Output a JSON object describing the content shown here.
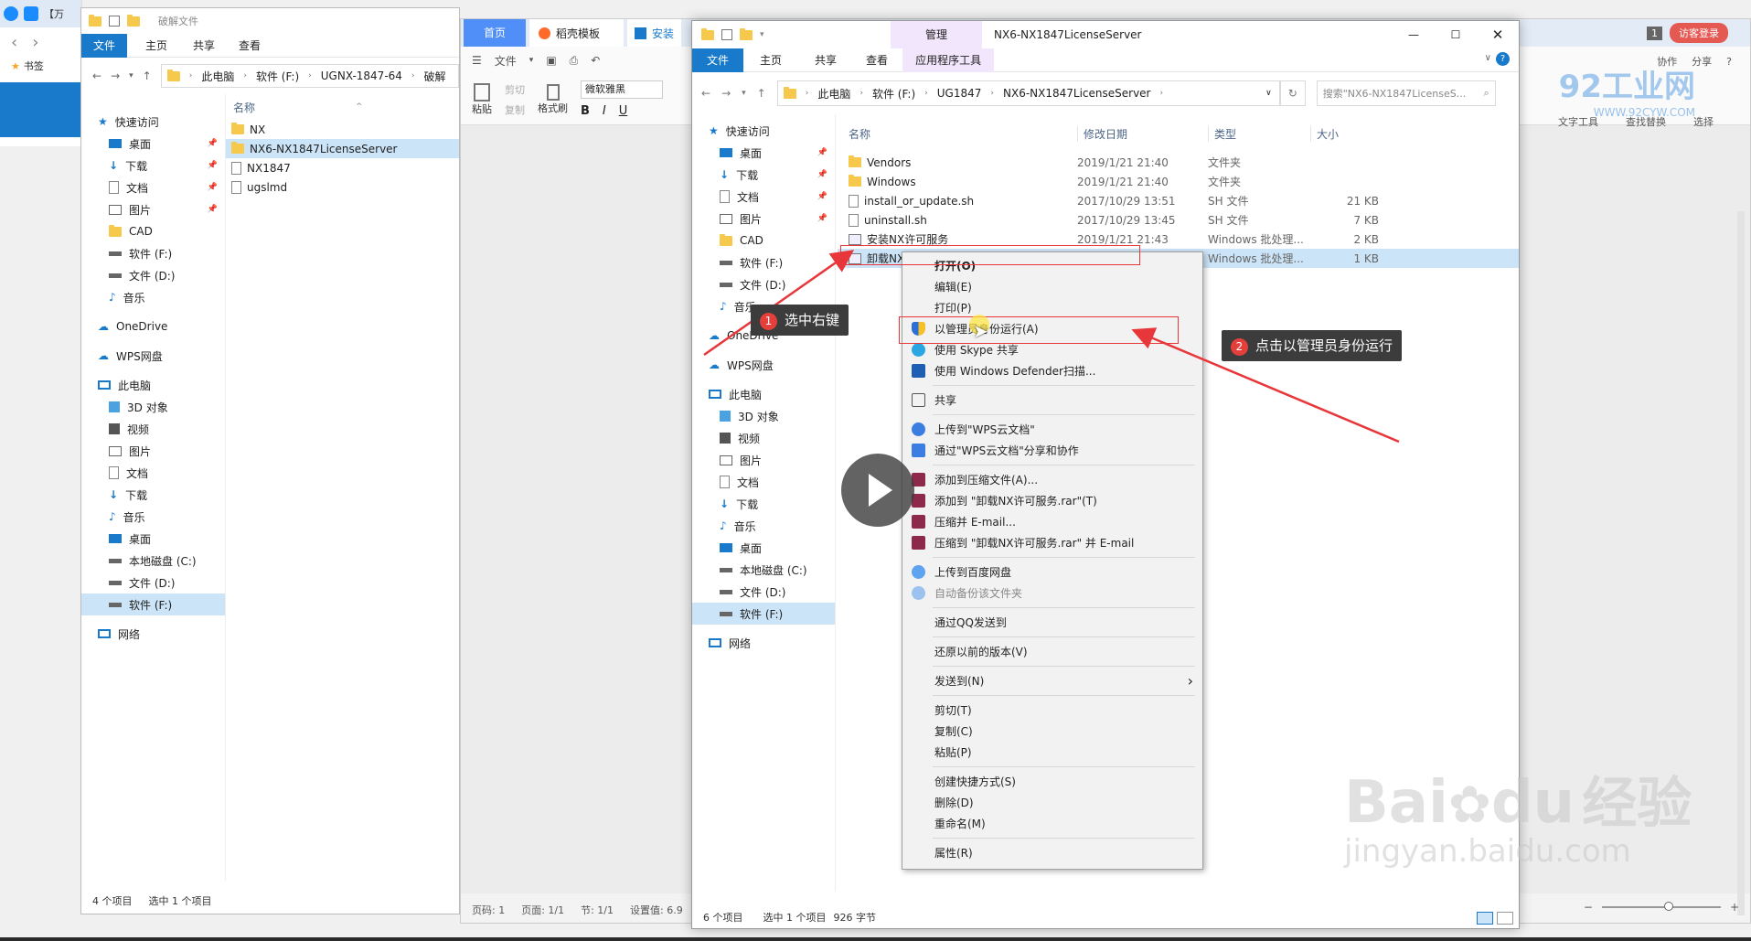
{
  "browser": {
    "tab_title": "【万",
    "bookmarks_label": "书签"
  },
  "left_explorer": {
    "title": "破解文件",
    "ribbon_tabs": [
      "文件",
      "主页",
      "共享",
      "查看"
    ],
    "path": [
      "此电脑",
      "软件 (F:)",
      "UGNX-1847-64",
      "破解"
    ],
    "column_name": "名称",
    "files": [
      "NX",
      "NX6-NX1847LicenseServer",
      "NX1847",
      "ugslmd"
    ],
    "nav": {
      "quick_access": "快速访问",
      "quick_items": [
        "桌面",
        "下载",
        "文档",
        "图片",
        "CAD",
        "软件 (F:)",
        "文件 (D:)",
        "音乐"
      ],
      "onedrive": "OneDrive",
      "wps": "WPS网盘",
      "this_pc": "此电脑",
      "pc_items": [
        "3D 对象",
        "视频",
        "图片",
        "文档",
        "下载",
        "音乐",
        "桌面",
        "本地磁盘 (C:)",
        "文件 (D:)",
        "软件 (F:)"
      ],
      "network": "网络"
    },
    "status_count": "4 个项目",
    "status_selected": "选中 1 个项目"
  },
  "wps": {
    "tab_home": "首页",
    "tab_template": "稻壳模板",
    "tab_doc": "安装",
    "menu_file": "文件",
    "font_name": "微软雅黑",
    "paste_label": "粘贴",
    "cut_label": "剪切",
    "copy_label": "复制",
    "format_painter": "格式刷",
    "status": {
      "page_no": "页码: 1",
      "pages": "页面: 1/1",
      "section": "节: 1/1",
      "settings": "设置值: 6.9"
    },
    "right_toolbar": {
      "collab": "协作",
      "share": "分享",
      "login": "访客登录",
      "text_tools": "文字工具",
      "find_replace": "查找替换",
      "select": "选择"
    },
    "badge_count": "1",
    "watermark_site": "WWW.92CYW.COM",
    "watermark_brand": "92工业网"
  },
  "main_explorer": {
    "title": "NX6-NX1847LicenseServer",
    "manage_tab": "管理",
    "app_tools_tab": "应用程序工具",
    "ribbon_tabs": [
      "文件",
      "主页",
      "共享",
      "查看"
    ],
    "path": [
      "此电脑",
      "软件 (F:)",
      "UG1847",
      "NX6-NX1847LicenseServer"
    ],
    "search_placeholder": "搜索\"NX6-NX1847LicenseS...",
    "columns": {
      "name": "名称",
      "date": "修改日期",
      "type": "类型",
      "size": "大小"
    },
    "files": [
      {
        "name": "Vendors",
        "date": "2019/1/21 21:40",
        "type": "文件夹",
        "size": "",
        "kind": "folder"
      },
      {
        "name": "Windows",
        "date": "2019/1/21 21:40",
        "type": "文件夹",
        "size": "",
        "kind": "folder"
      },
      {
        "name": "install_or_update.sh",
        "date": "2017/10/29 13:51",
        "type": "SH 文件",
        "size": "21 KB",
        "kind": "doc"
      },
      {
        "name": "uninstall.sh",
        "date": "2017/10/29 13:45",
        "type": "SH 文件",
        "size": "7 KB",
        "kind": "doc"
      },
      {
        "name": "安装NX许可服务",
        "date": "2019/1/21 21:43",
        "type": "Windows 批处理...",
        "size": "2 KB",
        "kind": "bat"
      },
      {
        "name": "卸载NX许可服务",
        "date": "2019/1/21 21:40",
        "type": "Windows 批处理...",
        "size": "1 KB",
        "kind": "bat"
      }
    ],
    "nav": {
      "quick_access": "快速访问",
      "quick_items": [
        "桌面",
        "下载",
        "文档",
        "图片",
        "CAD",
        "软件 (F:)",
        "文件 (D:)",
        "音乐"
      ],
      "onedrive": "OneDrive",
      "wps": "WPS网盘",
      "this_pc": "此电脑",
      "pc_items": [
        "3D 对象",
        "视频",
        "图片",
        "文档",
        "下载",
        "音乐",
        "桌面",
        "本地磁盘 (C:)",
        "文件 (D:)",
        "软件 (F:)"
      ],
      "network": "网络"
    },
    "status_count": "6 个项目",
    "status_selected": "选中 1 个项目",
    "status_size": "926 字节"
  },
  "context_menu": {
    "open": "打开(O)",
    "edit": "编辑(E)",
    "print": "打印(P)",
    "run_as_admin": "以管理员身份运行(A)",
    "skype": "使用 Skype 共享",
    "defender": "使用 Windows Defender扫描...",
    "share": "共享",
    "wps_upload": "上传到\"WPS云文档\"",
    "wps_share": "通过\"WPS云文档\"分享和协作",
    "add_archive": "添加到压缩文件(A)...",
    "add_rar": "添加到 \"卸载NX许可服务.rar\"(T)",
    "zip_email": "压缩并 E-mail...",
    "rar_email": "压缩到 \"卸载NX许可服务.rar\" 并 E-mail",
    "baidu_upload": "上传到百度网盘",
    "baidu_backup": "自动备份该文件夹",
    "qq_send": "通过QQ发送到",
    "restore": "还原以前的版本(V)",
    "send_to": "发送到(N)",
    "cut": "剪切(T)",
    "copy": "复制(C)",
    "paste": "粘贴(P)",
    "shortcut": "创建快捷方式(S)",
    "delete": "删除(D)",
    "rename": "重命名(M)",
    "properties": "属性(R)"
  },
  "annotations": {
    "step1_num": "1",
    "step1_text": "选中右键",
    "step2_num": "2",
    "step2_text": "点击以管理员身份运行"
  },
  "watermark": {
    "brand_latin": "Bai",
    "brand_du": "du",
    "brand_cn": "经验",
    "url": "jingyan.baidu.com"
  },
  "colors": {
    "accent": "#1979ca",
    "annotation_red": "#e8373b",
    "selection": "#cce4f7"
  }
}
